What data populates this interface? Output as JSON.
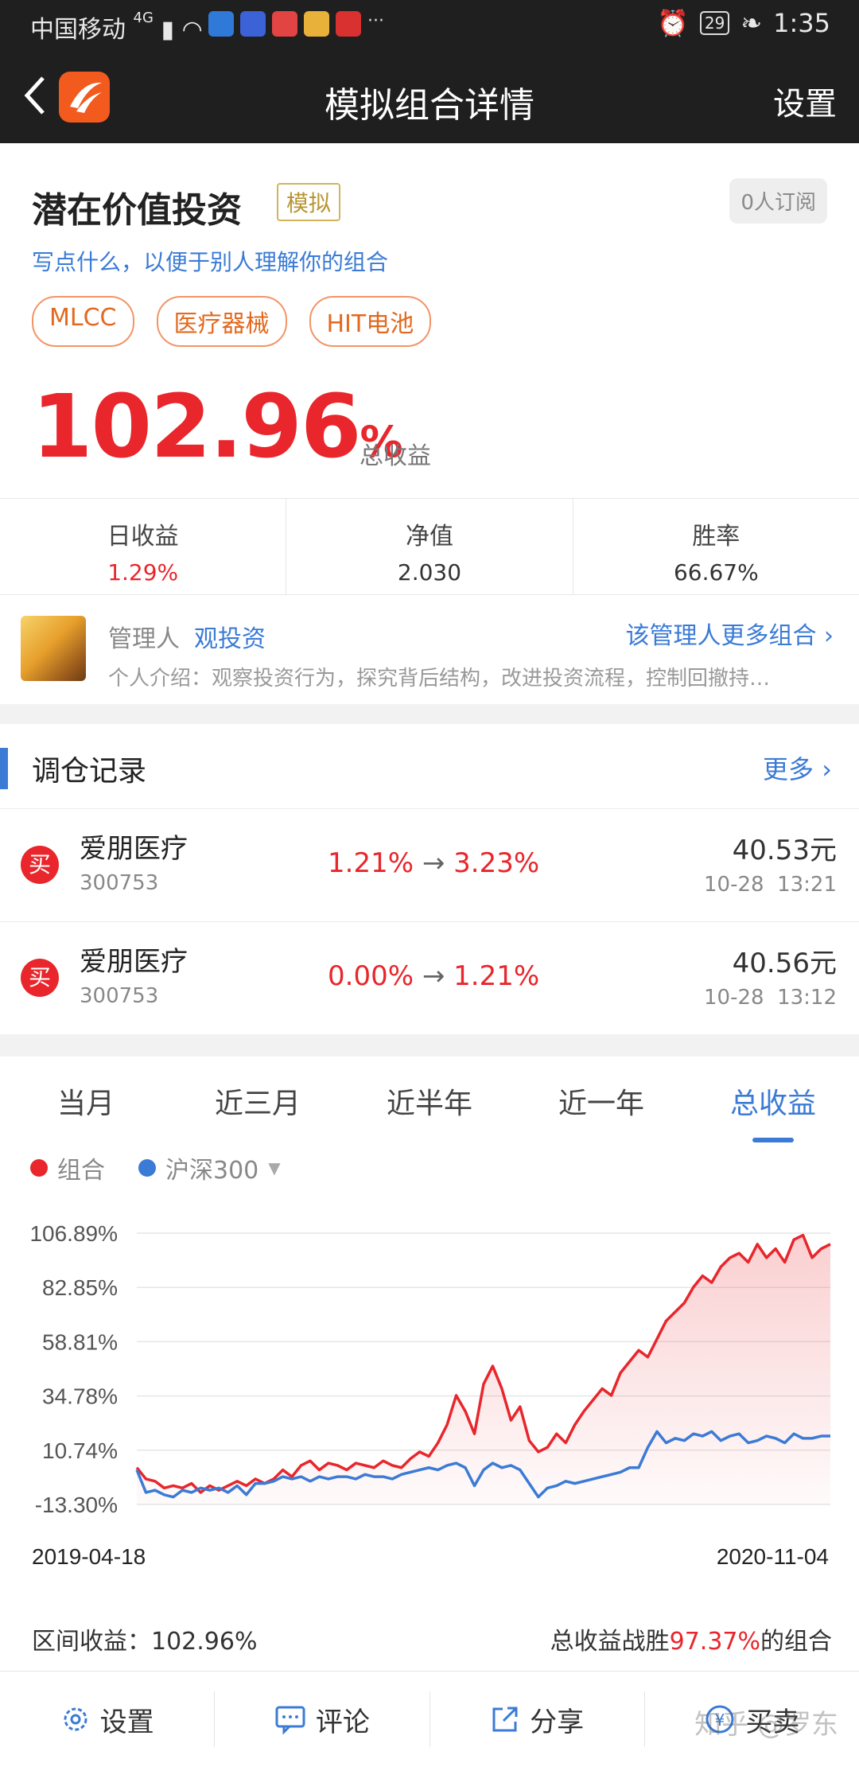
{
  "status": {
    "carrier": "中国移动",
    "network": "4G",
    "battery": "29",
    "time": "1:35",
    "more": "···"
  },
  "nav": {
    "title": "模拟组合详情",
    "settings": "设置"
  },
  "portfolio": {
    "name": "潜在价值投资",
    "badge": "模拟",
    "subscribers": "0人订阅",
    "desc": "写点什么，以便于别人理解你的组合",
    "tags": [
      "MLCC",
      "医疗器械",
      "HIT电池"
    ],
    "total_return": "102.96",
    "total_return_unit": "%",
    "total_return_label": "总收益"
  },
  "stats": [
    {
      "label": "日收益",
      "value": "1.29%"
    },
    {
      "label": "净值",
      "value": "2.030"
    },
    {
      "label": "胜率",
      "value": "66.67%"
    }
  ],
  "manager": {
    "role": "管理人",
    "name": "观投资",
    "more": "该管理人更多组合",
    "intro": "个人介绍：观察投资行为，探究背后结构，改进投资流程，控制回撤持…"
  },
  "trades": {
    "title": "调仓记录",
    "more": "更多",
    "rows": [
      {
        "action": "买",
        "name": "爱朋医疗",
        "code": "300753",
        "from": "1.21%",
        "arrow": "→",
        "to": "3.23%",
        "price": "40.53元",
        "time": "10-28  13:21"
      },
      {
        "action": "买",
        "name": "爱朋医疗",
        "code": "300753",
        "from": "0.00%",
        "arrow": "→",
        "to": "1.21%",
        "price": "40.56元",
        "time": "10-28  13:12"
      }
    ]
  },
  "tabs": [
    "当月",
    "近三月",
    "近半年",
    "近一年",
    "总收益"
  ],
  "legend": {
    "portfolio": "组合",
    "index": "沪深300"
  },
  "colors": {
    "portfolio": "#e8262c",
    "index": "#3b7bd6",
    "accent": "#3b7bd6"
  },
  "chart_data": {
    "type": "line",
    "x_start": "2019-04-18",
    "x_end": "2020-11-04",
    "y_ticks": [
      "106.89%",
      "82.85%",
      "58.81%",
      "34.78%",
      "10.74%",
      "-13.30%"
    ],
    "ylim": [
      -13.3,
      106.89
    ],
    "series": [
      {
        "name": "组合",
        "values": [
          3,
          -2,
          -3,
          -6,
          -5,
          -6,
          -4,
          -8,
          -5,
          -7,
          -5,
          -3,
          -5,
          -2,
          -4,
          -2,
          2,
          -1,
          4,
          6,
          2,
          5,
          4,
          2,
          5,
          4,
          3,
          6,
          4,
          3,
          7,
          10,
          8,
          14,
          22,
          35,
          28,
          18,
          40,
          48,
          38,
          24,
          30,
          15,
          10,
          12,
          18,
          14,
          22,
          28,
          33,
          38,
          35,
          45,
          50,
          55,
          52,
          60,
          68,
          72,
          76,
          83,
          88,
          85,
          92,
          96,
          98,
          94,
          102,
          96,
          100,
          94,
          104,
          106,
          96,
          100,
          102
        ]
      },
      {
        "name": "沪深300",
        "values": [
          2,
          -8,
          -7,
          -9,
          -10,
          -7,
          -8,
          -6,
          -7,
          -6,
          -8,
          -5,
          -9,
          -4,
          -4,
          -3,
          -1,
          -2,
          -1,
          -3,
          -1,
          -2,
          -1,
          -1,
          -2,
          0,
          -1,
          -1,
          -2,
          0,
          1,
          2,
          3,
          2,
          4,
          5,
          3,
          -5,
          2,
          5,
          3,
          4,
          2,
          -4,
          -10,
          -6,
          -5,
          -3,
          -4,
          -3,
          -2,
          -1,
          0,
          1,
          3,
          3,
          12,
          19,
          14,
          16,
          15,
          18,
          17,
          19,
          15,
          17,
          18,
          14,
          15,
          17,
          16,
          14,
          18,
          16,
          16,
          17,
          17
        ]
      }
    ]
  },
  "summary": {
    "range_label": "区间收益：",
    "range_value": "102.96%",
    "beat_prefix": "总收益战胜",
    "beat_value": "97.37%",
    "beat_suffix": "的组合"
  },
  "bottom": [
    "设置",
    "评论",
    "分享",
    "买卖"
  ],
  "watermark": "知乎 @罗东"
}
